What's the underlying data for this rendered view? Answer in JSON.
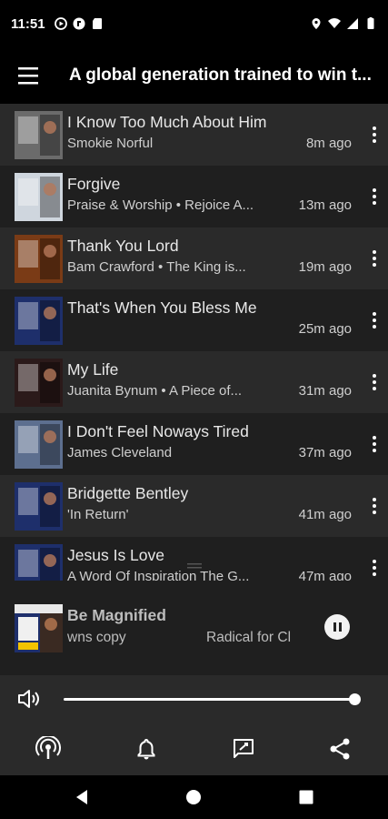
{
  "status_bar": {
    "time": "11:51"
  },
  "app_bar": {
    "title": "A global generation trained to win t..."
  },
  "tracks": [
    {
      "title": "I Know Too Much About Him",
      "subtitle": "Smokie Norful",
      "time": "8m ago",
      "thumb_color": "#6b6b6b"
    },
    {
      "title": "Forgive",
      "subtitle": "Praise & Worship • Rejoice A...",
      "time": "13m ago",
      "thumb_color": "#cfd6de"
    },
    {
      "title": "Thank You Lord",
      "subtitle": "Bam Crawford • The King is...",
      "time": "19m ago",
      "thumb_color": "#7a3b16"
    },
    {
      "title": "That's When You Bless Me",
      "subtitle": "",
      "time": "25m ago",
      "thumb_color": "#1e2f6b"
    },
    {
      "title": "My Life",
      "subtitle": "Juanita Bynum • A Piece of...",
      "time": "31m ago",
      "thumb_color": "#2b1a1a"
    },
    {
      "title": "I Don't Feel Noways Tired",
      "subtitle": "James Cleveland",
      "time": "37m ago",
      "thumb_color": "#5d6f8f"
    },
    {
      "title": "Bridgette Bentley",
      "subtitle": "'In Return'",
      "time": "41m ago",
      "thumb_color": "#1e2f6b"
    },
    {
      "title": "Jesus Is Love",
      "subtitle": "A Word Of Inspiration The G...",
      "time": "47m ago",
      "thumb_color": "#1e2f6b"
    }
  ],
  "now_playing": {
    "title": "Be Magnified",
    "subtitle": "wns copy",
    "subtitle2": "Radical for Cl",
    "thumb_color": "#1e2f6b"
  },
  "volume": {
    "level": 1.0
  },
  "icons": {
    "menu": "menu-icon",
    "more": "more-vert-icon",
    "pause": "pause-icon",
    "volume": "volume-icon",
    "podcast": "podcast-icon",
    "bell": "bell-icon",
    "message": "message-icon",
    "share": "share-icon"
  }
}
